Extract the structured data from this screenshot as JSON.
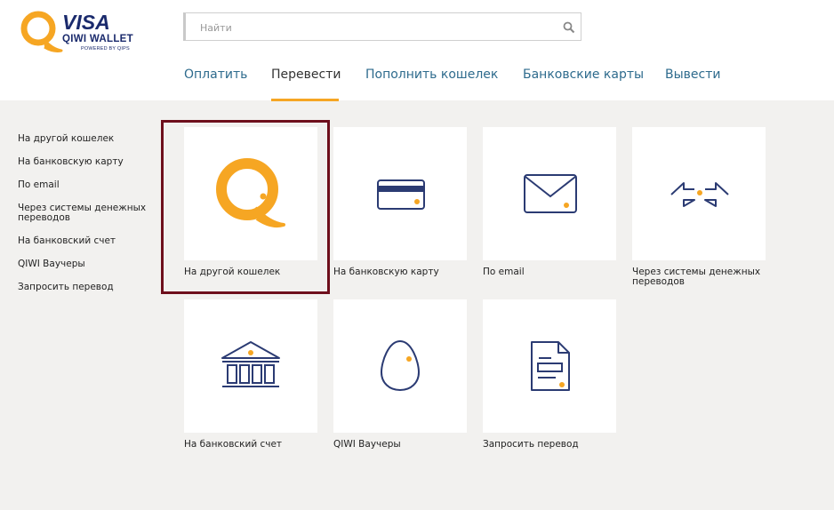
{
  "logo": {
    "brand": "VISA",
    "product": "QIWI WALLET",
    "tagline": "POWERED BY QIPS"
  },
  "search": {
    "placeholder": "Найти",
    "icon": "search-icon"
  },
  "nav": {
    "items": [
      {
        "label": "Оплатить",
        "active": false
      },
      {
        "label": "Перевести",
        "active": true
      },
      {
        "label": "Пополнить кошелек",
        "active": false
      },
      {
        "label": "Банковские карты",
        "active": false
      },
      {
        "label": "Вывести",
        "active": false
      }
    ]
  },
  "sidebar": {
    "items": [
      {
        "label": "На другой кошелек"
      },
      {
        "label": "На банковскую карту"
      },
      {
        "label": "По email"
      },
      {
        "label": "Через системы денежных переводов"
      },
      {
        "label": "На банковский счет"
      },
      {
        "label": "QIWI Ваучеры"
      },
      {
        "label": "Запросить перевод"
      }
    ]
  },
  "tiles": [
    {
      "label": "На другой кошелек",
      "icon": "qiwi-logo-icon",
      "selected": true
    },
    {
      "label": "На банковскую карту",
      "icon": "credit-card-icon"
    },
    {
      "label": "По email",
      "icon": "envelope-icon"
    },
    {
      "label": "Через системы денежных переводов",
      "icon": "transfer-arrows-icon"
    },
    {
      "label": "На банковский счет",
      "icon": "bank-building-icon"
    },
    {
      "label": "QIWI Ваучеры",
      "icon": "egg-voucher-icon"
    },
    {
      "label": "Запросить перевод",
      "icon": "document-request-icon"
    }
  ],
  "colors": {
    "accent": "#f6a623",
    "icon_navy": "#2b3b73",
    "nav_link": "#2e6b8d",
    "highlight_border": "#6e0f1c",
    "background": "#f2f1ef"
  }
}
